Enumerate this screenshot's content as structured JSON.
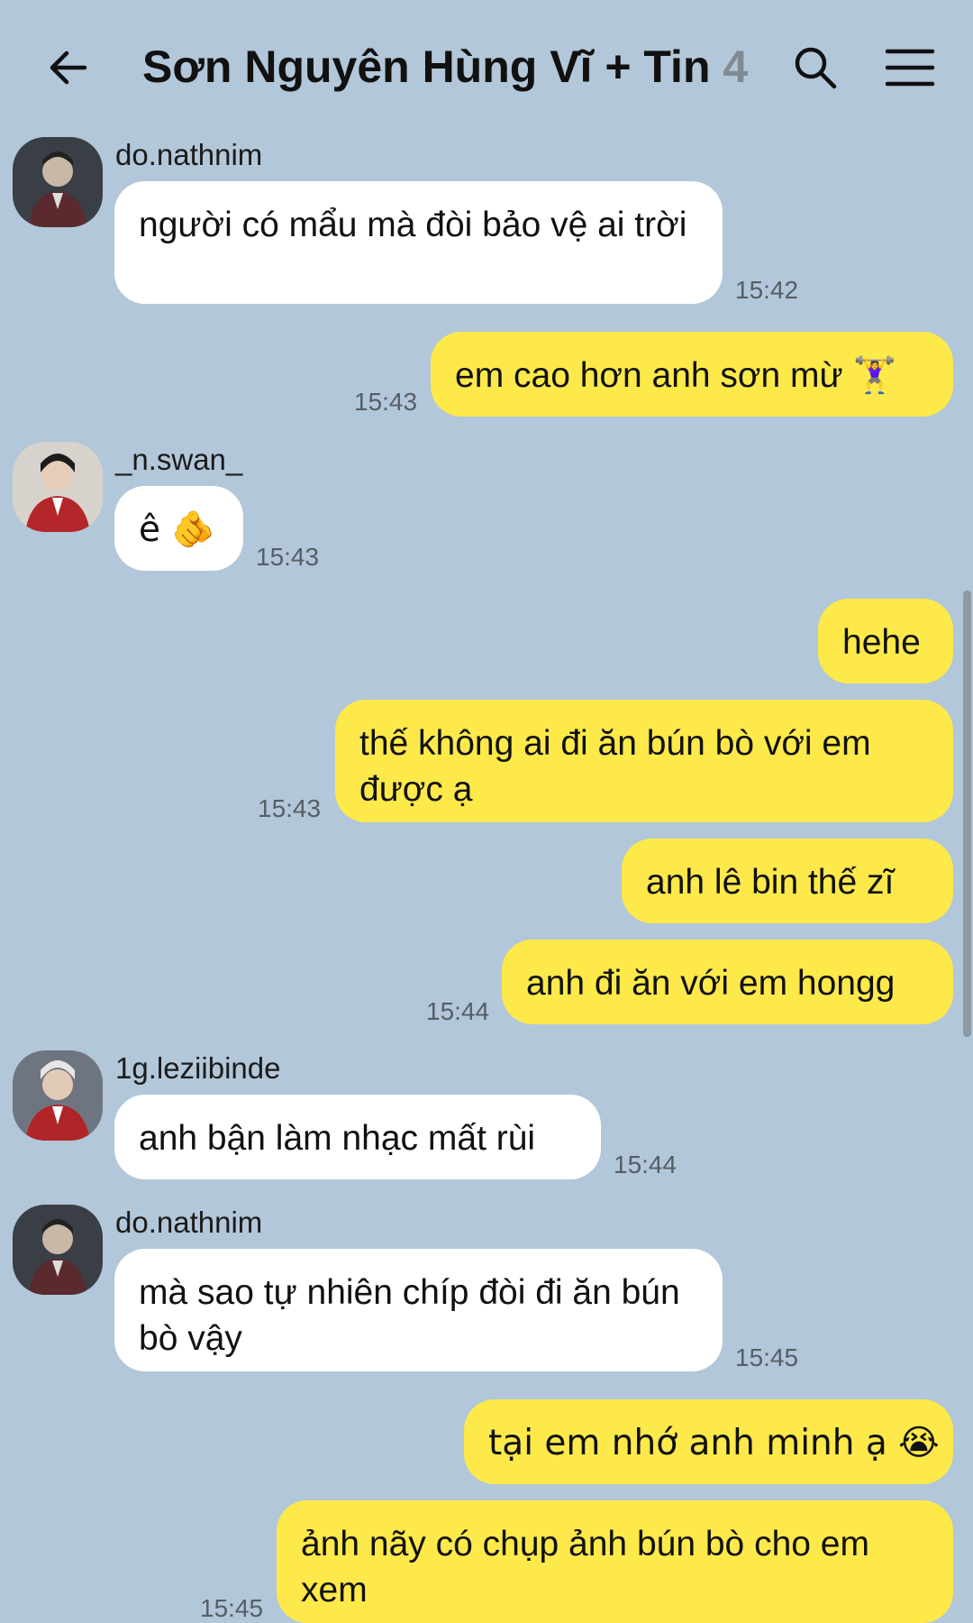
{
  "header": {
    "title": "Sơn Nguyên Hùng Vĩ + Tin",
    "member_count": "4",
    "back_icon": "arrow-left-icon",
    "search_icon": "search-icon",
    "menu_icon": "hamburger-menu-icon"
  },
  "colors": {
    "background": "#b2c7d9",
    "outgoing_bubble": "#fde94a",
    "incoming_bubble": "#ffffff",
    "timestamp": "#555e66"
  },
  "messages": [
    {
      "sender": "do.nathnim",
      "text": "người có mẩu mà đòi bảo vệ ai trời",
      "time": "15:42",
      "direction": "in"
    },
    {
      "text": "em cao hơn anh sơn mừ 🏋‍♀",
      "time": "15:43",
      "direction": "out"
    },
    {
      "sender": "_n.swan_",
      "text": "ê 🫵",
      "time": "15:43",
      "direction": "in"
    },
    {
      "text": "hehe",
      "direction": "out"
    },
    {
      "text": "thế không ai đi ăn bún bò với em được ạ",
      "time": "15:43",
      "direction": "out"
    },
    {
      "text": "anh lê bin thế zĩ",
      "direction": "out"
    },
    {
      "text": "anh đi ăn với em hongg",
      "time": "15:44",
      "direction": "out"
    },
    {
      "sender": "1g.leziibinde",
      "text": "anh bận làm nhạc mất rùi",
      "time": "15:44",
      "direction": "in"
    },
    {
      "sender": "do.nathnim",
      "text": "mà sao tự nhiên chíp đòi đi ăn bún bò vậy",
      "time": "15:45",
      "direction": "in"
    },
    {
      "text": "tại em nhớ anh minh ạ 😭",
      "direction": "out"
    },
    {
      "text": "ảnh nãy có chụp ảnh bún bò cho em xem",
      "time": "15:45",
      "direction": "out"
    }
  ]
}
